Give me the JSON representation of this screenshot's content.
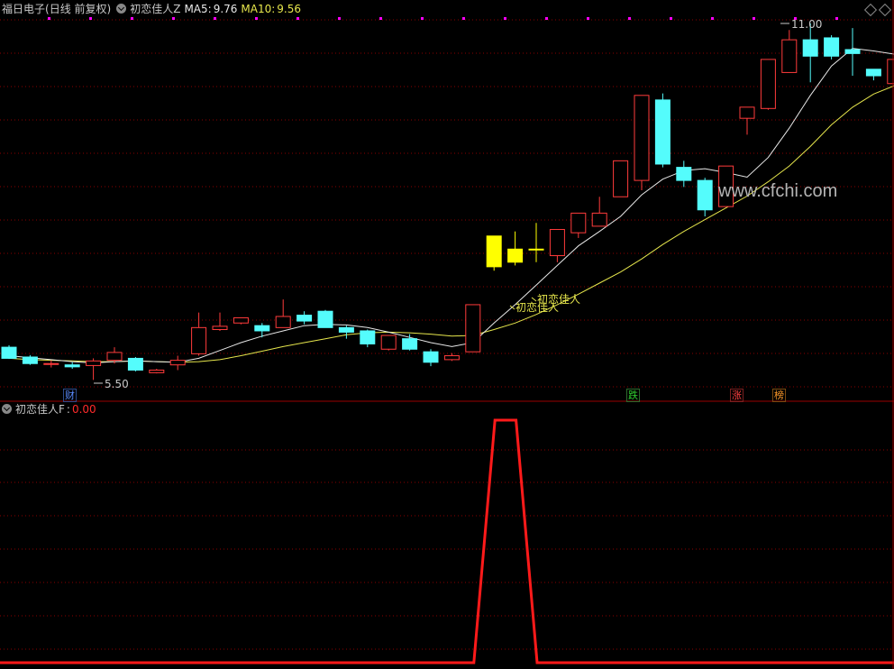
{
  "header": {
    "title": "福日电子",
    "adjust": "(日线 前复权)",
    "indicator": "初恋佳人Z",
    "ma5_label": "MA5:",
    "ma5_value": "9.76",
    "ma10_label": "MA10:",
    "ma10_value": "9.56"
  },
  "sub_header": {
    "indicator": "初恋佳人F",
    "separator": ":",
    "value": "0.00"
  },
  "annotations": {
    "high_label": "11.00",
    "low_label": "5.50",
    "signal_label_1": "初恋佳人",
    "signal_label_2": "初恋佳人",
    "watermark": "www.cfchi.com"
  },
  "event_flags": [
    {
      "text": "财",
      "color": "#5a8cff"
    },
    {
      "text": "跌",
      "color": "#30d030"
    },
    {
      "text": "涨",
      "color": "#ff4040"
    },
    {
      "text": "榜",
      "color": "#ff9a2a"
    }
  ],
  "colors": {
    "background": "#000000",
    "up_candle": "#ff3b3b",
    "down_candle": "#54fcfc",
    "signal_candle": "#ffff00",
    "ma5": "#e8e8e8",
    "ma10": "#e6e64c",
    "grid": "#8a0000",
    "indicator_line": "#ff1a1a",
    "dot_marker": "#ff00ff"
  },
  "candles": [
    {
      "o": 6.05,
      "h": 6.08,
      "c": 5.88,
      "l": 5.87
    },
    {
      "o": 5.9,
      "h": 5.93,
      "c": 5.8,
      "l": 5.78
    },
    {
      "o": 5.8,
      "h": 5.85,
      "c": 5.8,
      "l": 5.74
    },
    {
      "o": 5.78,
      "h": 5.82,
      "c": 5.75,
      "l": 5.72
    },
    {
      "o": 5.77,
      "h": 5.88,
      "c": 5.84,
      "l": 5.55
    },
    {
      "o": 5.85,
      "h": 6.05,
      "c": 5.97,
      "l": 5.8
    },
    {
      "o": 5.88,
      "h": 5.9,
      "c": 5.7,
      "l": 5.68
    },
    {
      "o": 5.66,
      "h": 5.72,
      "c": 5.7,
      "l": 5.65
    },
    {
      "o": 5.78,
      "h": 5.92,
      "c": 5.85,
      "l": 5.7
    },
    {
      "o": 5.95,
      "h": 6.58,
      "c": 6.35,
      "l": 5.92
    },
    {
      "o": 6.32,
      "h": 6.58,
      "c": 6.37,
      "l": 6.3
    },
    {
      "o": 6.42,
      "h": 6.5,
      "c": 6.5,
      "l": 6.4
    },
    {
      "o": 6.38,
      "h": 6.42,
      "c": 6.3,
      "l": 6.2
    },
    {
      "o": 6.35,
      "h": 6.78,
      "c": 6.52,
      "l": 6.35
    },
    {
      "o": 6.54,
      "h": 6.6,
      "c": 6.45,
      "l": 6.4
    },
    {
      "o": 6.6,
      "h": 6.62,
      "c": 6.35,
      "l": 6.35
    },
    {
      "o": 6.35,
      "h": 6.38,
      "c": 6.28,
      "l": 6.18
    },
    {
      "o": 6.3,
      "h": 6.32,
      "c": 6.1,
      "l": 6.05
    },
    {
      "o": 6.02,
      "h": 6.23,
      "c": 6.23,
      "l": 6.0
    },
    {
      "o": 6.18,
      "h": 6.25,
      "c": 6.02,
      "l": 6.0
    },
    {
      "o": 5.98,
      "h": 6.02,
      "c": 5.82,
      "l": 5.76
    },
    {
      "o": 5.86,
      "h": 5.96,
      "c": 5.92,
      "l": 5.84
    },
    {
      "o": 5.98,
      "h": 6.7,
      "c": 6.7,
      "l": 5.98
    },
    {
      "o": 7.28,
      "h": 7.75,
      "c": 7.75,
      "l": 7.22,
      "s": 1
    },
    {
      "o": 7.55,
      "h": 7.82,
      "c": 7.35,
      "l": 7.3,
      "s": 1
    },
    {
      "o": 7.55,
      "h": 7.95,
      "c": 7.55,
      "l": 7.35,
      "s": 1
    },
    {
      "o": 7.45,
      "h": 7.85,
      "c": 7.85,
      "l": 7.35
    },
    {
      "o": 7.8,
      "h": 8.1,
      "c": 8.1,
      "l": 7.72
    },
    {
      "o": 7.9,
      "h": 8.35,
      "c": 8.1,
      "l": 7.9
    },
    {
      "o": 8.35,
      "h": 8.9,
      "c": 8.9,
      "l": 8.35
    },
    {
      "o": 8.6,
      "h": 9.9,
      "c": 9.9,
      "l": 8.45
    },
    {
      "o": 9.83,
      "h": 9.93,
      "c": 8.85,
      "l": 8.8
    },
    {
      "o": 8.8,
      "h": 8.9,
      "c": 8.6,
      "l": 8.5
    },
    {
      "o": 8.6,
      "h": 8.64,
      "c": 8.15,
      "l": 8.05
    },
    {
      "o": 8.2,
      "h": 8.82,
      "c": 8.82,
      "l": 8.2
    },
    {
      "o": 9.55,
      "h": 9.72,
      "c": 9.72,
      "l": 9.3
    },
    {
      "o": 9.7,
      "h": 10.45,
      "c": 10.45,
      "l": 9.68
    },
    {
      "o": 10.25,
      "h": 10.9,
      "c": 10.75,
      "l": 10.25
    },
    {
      "o": 10.75,
      "h": 11.0,
      "c": 10.5,
      "l": 10.1
    },
    {
      "o": 10.78,
      "h": 10.82,
      "c": 10.5,
      "l": 10.45
    },
    {
      "o": 10.6,
      "h": 10.93,
      "c": 10.54,
      "l": 10.2
    },
    {
      "o": 10.3,
      "h": 10.3,
      "c": 10.2,
      "l": 10.13
    },
    {
      "o": 10.08,
      "h": 10.65,
      "c": 10.45,
      "l": 10.05
    },
    {
      "o": 10.58,
      "h": 10.62,
      "c": 10.38,
      "l": 10.3
    }
  ],
  "ma5": [
    5.92,
    5.89,
    5.86,
    5.83,
    5.81,
    5.83,
    5.84,
    5.83,
    5.82,
    5.88,
    6.0,
    6.12,
    6.22,
    6.3,
    6.38,
    6.4,
    6.39,
    6.35,
    6.28,
    6.2,
    6.12,
    6.06,
    6.12,
    6.42,
    6.7,
    7.0,
    7.3,
    7.6,
    7.82,
    8.05,
    8.38,
    8.62,
    8.75,
    8.78,
    8.72,
    8.65,
    8.95,
    9.4,
    9.9,
    10.35,
    10.62,
    10.58,
    10.53,
    10.44
  ],
  "ma10": [
    5.88,
    5.86,
    5.85,
    5.84,
    5.83,
    5.83,
    5.84,
    5.83,
    5.82,
    5.83,
    5.86,
    5.92,
    5.99,
    6.06,
    6.12,
    6.18,
    6.24,
    6.27,
    6.28,
    6.27,
    6.25,
    6.22,
    6.23,
    6.32,
    6.42,
    6.55,
    6.7,
    6.86,
    7.03,
    7.2,
    7.4,
    7.62,
    7.82,
    8.0,
    8.18,
    8.36,
    8.58,
    8.82,
    9.12,
    9.45,
    9.72,
    9.92,
    10.05,
    10.18
  ],
  "indicator_F": [
    0,
    0,
    0,
    0,
    0,
    0,
    0,
    0,
    0,
    0,
    0,
    0,
    0,
    0,
    0,
    0,
    0,
    0,
    0,
    0,
    0,
    0,
    0,
    1,
    1,
    0,
    0,
    0,
    0,
    0,
    0,
    0,
    0,
    0,
    0,
    0,
    0,
    0,
    0,
    0,
    0,
    0,
    0,
    0
  ]
}
